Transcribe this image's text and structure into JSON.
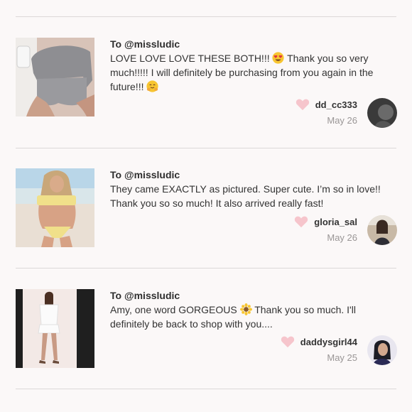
{
  "reviews": [
    {
      "to": "To @missludic",
      "text_a": "LOVE LOVE LOVE THESE BOTH!!! ",
      "emoji_a": "heart-eyes-emoji",
      "text_b": " Thank you so very much!!!!! I will definitely be purchasing from you again in the future!!! ",
      "emoji_b": "hugging-emoji",
      "text_c": "",
      "username": "dd_cc333",
      "date": "May 26"
    },
    {
      "to": "To @missludic",
      "text_a": "They came EXACTLY as pictured. Super cute. I’m so in love!! Thank you so so much! It also arrived really fast!",
      "username": "gloria_sal",
      "date": "May 26"
    },
    {
      "to": "To @missludic",
      "text_a": "Amy, one word GORGEOUS ",
      "emoji_a": "sunflower-emoji",
      "text_b": " Thank you so much. I'll definitely be back to shop with you....",
      "username": "daddysgirl44",
      "date": "May 25"
    }
  ],
  "colors": {
    "heart": "#f6c5cc",
    "divider": "#dcd8d8",
    "background": "#fbf8f8"
  }
}
